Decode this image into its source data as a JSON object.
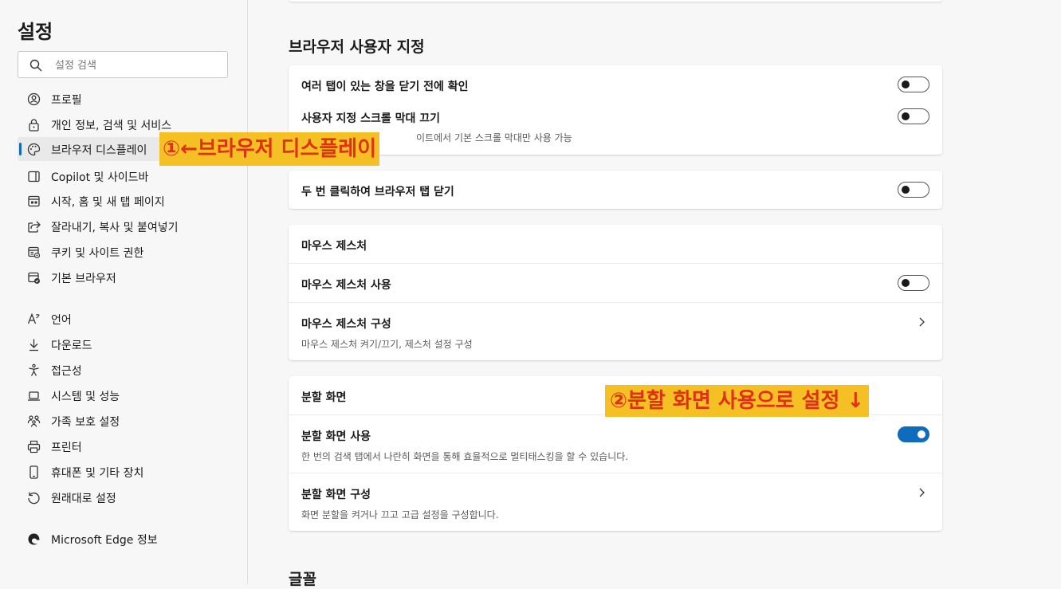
{
  "sidebar": {
    "title": "설정",
    "search_placeholder": "설정 검색",
    "items": [
      {
        "label": "프로필",
        "icon": "profile-icon"
      },
      {
        "label": "개인 정보, 검색 및 서비스",
        "icon": "lock-icon"
      },
      {
        "label": "브라우저 디스플레이",
        "icon": "palette-icon",
        "active": true
      },
      {
        "label": "Copilot 및 사이드바",
        "icon": "sidebar-icon"
      },
      {
        "label": "시작, 홈 및 새 탭 페이지",
        "icon": "home-tab-icon"
      },
      {
        "label": "잘라내기, 복사 및 붙여넣기",
        "icon": "share-icon"
      },
      {
        "label": "쿠키 및 사이트 권한",
        "icon": "site-permissions-icon"
      },
      {
        "label": "기본 브라우저",
        "icon": "browser-check-icon"
      },
      {
        "label": "언어",
        "icon": "language-icon"
      },
      {
        "label": "다운로드",
        "icon": "download-icon"
      },
      {
        "label": "접근성",
        "icon": "accessibility-icon"
      },
      {
        "label": "시스템 및 성능",
        "icon": "laptop-icon"
      },
      {
        "label": "가족 보호 설정",
        "icon": "family-icon"
      },
      {
        "label": "프린터",
        "icon": "printer-icon"
      },
      {
        "label": "휴대폰 및 기타 장치",
        "icon": "phone-icon"
      },
      {
        "label": "원래대로 설정",
        "icon": "reset-icon"
      },
      {
        "label": "Microsoft Edge 정보",
        "icon": "edge-logo-icon"
      }
    ]
  },
  "annotations": {
    "first": "①←브라우저 디스플레이",
    "second": "②분할 화면 사용으로 설정 ↓"
  },
  "main": {
    "section_customize": "브라우저 사용자 지정",
    "confirm_close": {
      "title": "여러 탭이 있는 창을 닫기 전에 확인",
      "on": false
    },
    "custom_scrollbar": {
      "title": "사용자 지정 스크롤 막대 끄기",
      "desc_visible": "이트에서 기본 스크롤 막대만 사용 가능",
      "on": false
    },
    "double_click_close": {
      "title": "두 번 클릭하여 브라우저 탭 닫기",
      "on": false
    },
    "mouse_gesture": {
      "header": "마우스 제스처",
      "use": {
        "title": "마우스 제스처 사용",
        "on": false
      },
      "configure": {
        "title": "마우스 제스처 구성",
        "desc": "마우스 제스처 켜기/끄기, 제스처 설정 구성"
      }
    },
    "split_screen": {
      "header": "분할 화면",
      "use": {
        "title": "분할 화면 사용",
        "desc": "한 번의 검색 탭에서 나란히 화면을 통해 효율적으로 멀티태스킹을 할 수 있습니다.",
        "on": true
      },
      "configure": {
        "title": "분할 화면 구성",
        "desc": "화면 분할을 켜거나 끄고 고급 설정을 구성합니다."
      }
    },
    "section_fonts": "글꼴"
  },
  "colors": {
    "accent": "#0f6cbd",
    "annotation_bg": "#f5c023",
    "annotation_text": "#e03016"
  }
}
